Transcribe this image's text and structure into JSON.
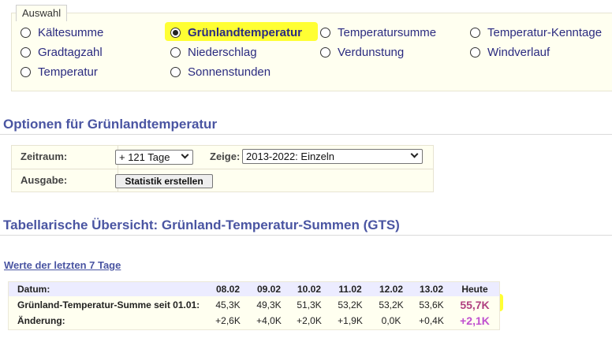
{
  "auswahl": {
    "legend": "Auswahl",
    "options": [
      {
        "label": "Kältesumme",
        "selected": false
      },
      {
        "label": "Grünlandtemperatur",
        "selected": true
      },
      {
        "label": "Temperatursumme",
        "selected": false
      },
      {
        "label": "Temperatur-Kenntage",
        "selected": false
      },
      {
        "label": "Gradtagzahl",
        "selected": false
      },
      {
        "label": "Niederschlag",
        "selected": false
      },
      {
        "label": "Verdunstung",
        "selected": false
      },
      {
        "label": "Windverlauf",
        "selected": false
      },
      {
        "label": "Temperatur",
        "selected": false
      },
      {
        "label": "Sonnenstunden",
        "selected": false
      }
    ]
  },
  "options_section": {
    "heading": "Optionen für Grünlandtemperatur",
    "zeitraum_label": "Zeitraum:",
    "zeitraum_value": "+ 121 Tage",
    "zeige_label": "Zeige:",
    "zeige_value": "2013-2022: Einzeln",
    "ausgabe_label": "Ausgabe:",
    "statistik_button": "Statistik erstellen"
  },
  "table_section": {
    "heading": "Tabellarische Übersicht: Grünland-Temperatur-Summen (GTS)",
    "link": "Werte der letzten 7 Tage",
    "header_label": "Datum:",
    "dates": [
      "08.02",
      "09.02",
      "10.02",
      "11.02",
      "12.02",
      "13.02",
      "Heute"
    ],
    "rows": [
      {
        "label": "Grünland-Temperatur-Summe seit 01.01:",
        "values": [
          "45,3K",
          "49,3K",
          "51,3K",
          "53,2K",
          "53,2K",
          "53,6K",
          "55,7K"
        ]
      },
      {
        "label": "Änderung:",
        "values": [
          "+2,6K",
          "+4,0K",
          "+2,0K",
          "+1,9K",
          "0,0K",
          "+0,4K",
          "+2,1K"
        ]
      }
    ]
  },
  "colors": {
    "highlight": "#ffff33",
    "heading": "#4a55a2",
    "today_sum": "#b04080",
    "today_change": "#c050d0"
  }
}
